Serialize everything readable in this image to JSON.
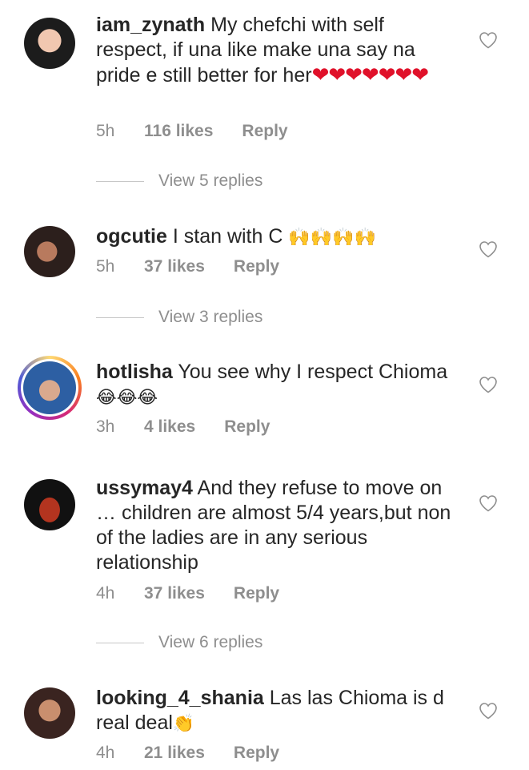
{
  "comments": [
    {
      "username": "iam_zynath",
      "text": "My chefchi with self respect, if una like make una say na pride e still better for her",
      "emoji": "❤❤❤❤❤❤❤",
      "time": "5h",
      "likes": "116 likes",
      "reply": "Reply",
      "view_replies": "View 5 replies",
      "avatar_color": "#2b2b2b"
    },
    {
      "username": "ogcutie",
      "text": "I stan with C",
      "emoji": "🙌🙌🙌🙌",
      "time": "5h",
      "likes": "37 likes",
      "reply": "Reply",
      "view_replies": "View 3 replies",
      "avatar_color": "#4a3a36"
    },
    {
      "username": "hotlisha",
      "text": "You see why I respect Chioma",
      "emoji": "😂😂😂",
      "time": "3h",
      "likes": "4 likes",
      "reply": "Reply",
      "avatar_color": "#7aa5d6"
    },
    {
      "username": "ussymay4",
      "text": "And they refuse to move on … children are almost 5/4 years,but non of the ladies are in any serious relationship",
      "time": "4h",
      "likes": "37 likes",
      "reply": "Reply",
      "view_replies": "View 6 replies",
      "avatar_color": "#8a2a1e"
    },
    {
      "username": "looking_4_shania",
      "text": "Las las Chioma is d real deal",
      "emoji": "👏",
      "time": "4h",
      "likes": "21 likes",
      "reply": "Reply",
      "avatar_color": "#c9896a"
    }
  ],
  "icons": {
    "like": "heart-outline-icon"
  },
  "colors": {
    "text": "#262626",
    "muted": "#8e8e8e",
    "heart_red": "#e0112a"
  }
}
